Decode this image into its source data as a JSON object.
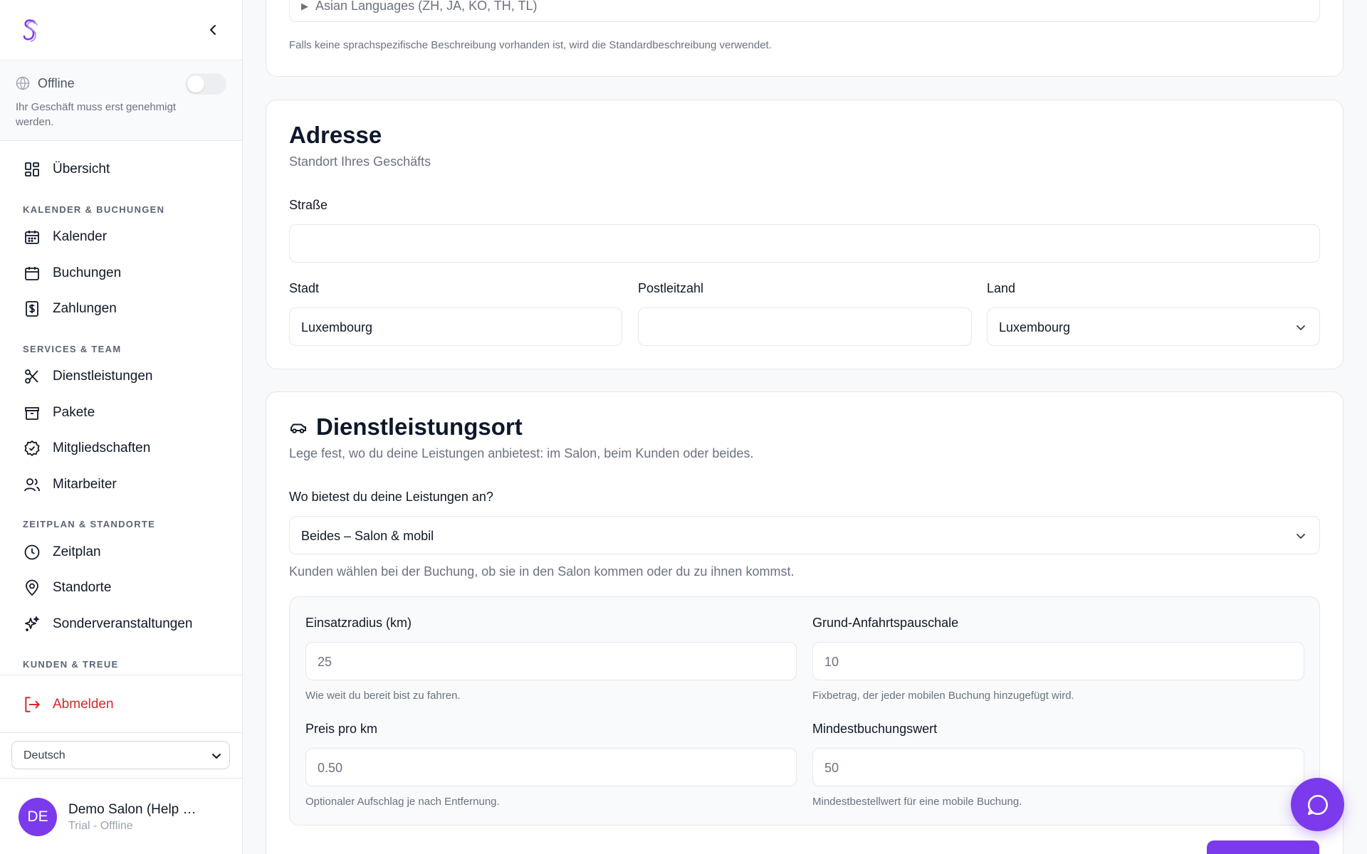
{
  "sidebar": {
    "status": {
      "label": "Offline",
      "note": "Ihr Geschäft muss erst genehmigt werden.",
      "toggle_on": false
    },
    "nav": {
      "overview": "Übersicht",
      "section_calendar": "KALENDER & BUCHUNGEN",
      "calendar": "Kalender",
      "bookings": "Buchungen",
      "payments": "Zahlungen",
      "section_services": "SERVICES & TEAM",
      "services": "Dienstleistungen",
      "packages": "Pakete",
      "memberships": "Mitgliedschaften",
      "staff": "Mitarbeiter",
      "section_schedule": "ZEITPLAN & STANDORTE",
      "schedule": "Zeitplan",
      "locations": "Standorte",
      "special_events": "Sonderveranstaltungen",
      "section_customers": "KUNDEN & TREUE"
    },
    "logout": "Abmelden",
    "language": "Deutsch",
    "user": {
      "initials": "DE",
      "name": "Demo Salon (Help …",
      "subtitle": "Trial - Offline"
    }
  },
  "description_card": {
    "collapsed_row": "Asian Languages (ZH, JA, KO, TH, TL)",
    "note": "Falls keine sprachspezifische Beschreibung vorhanden ist, wird die Standardbeschreibung verwendet."
  },
  "address": {
    "title": "Adresse",
    "subtitle": "Standort Ihres Geschäfts",
    "street_label": "Straße",
    "street_value": "",
    "city_label": "Stadt",
    "city_value": "Luxembourg",
    "zip_label": "Postleitzahl",
    "zip_value": "",
    "country_label": "Land",
    "country_value": "Luxembourg"
  },
  "service_location": {
    "title": "Dienstleistungsort",
    "subtitle": "Lege fest, wo du deine Leistungen anbietest: im Salon, beim Kunden oder beides.",
    "question": "Wo bietest du deine Leistungen an?",
    "selected": "Beides – Salon & mobil",
    "help": "Kunden wählen bei der Buchung, ob sie in den Salon kommen oder du zu ihnen kommst.",
    "mobile": {
      "radius_label": "Einsatzradius (km)",
      "radius_placeholder": "25",
      "radius_hint": "Wie weit du bereit bist zu fahren.",
      "base_fee_label": "Grund-Anfahrtspauschale",
      "base_fee_placeholder": "10",
      "base_fee_hint": "Fixbetrag, der jeder mobilen Buchung hinzugefügt wird.",
      "per_km_label": "Preis pro km",
      "per_km_placeholder": "0.50",
      "per_km_hint": "Optionaler Aufschlag je nach Entfernung.",
      "min_value_label": "Mindestbuchungswert",
      "min_value_placeholder": "50",
      "min_value_hint": "Mindestbestellwert für eine mobile Buchung."
    }
  },
  "icons": {
    "logo": "brand-s-logo",
    "chat": "chat-bubble-icon"
  },
  "colors": {
    "accent": "#7c3aed",
    "danger": "#dc2626"
  }
}
